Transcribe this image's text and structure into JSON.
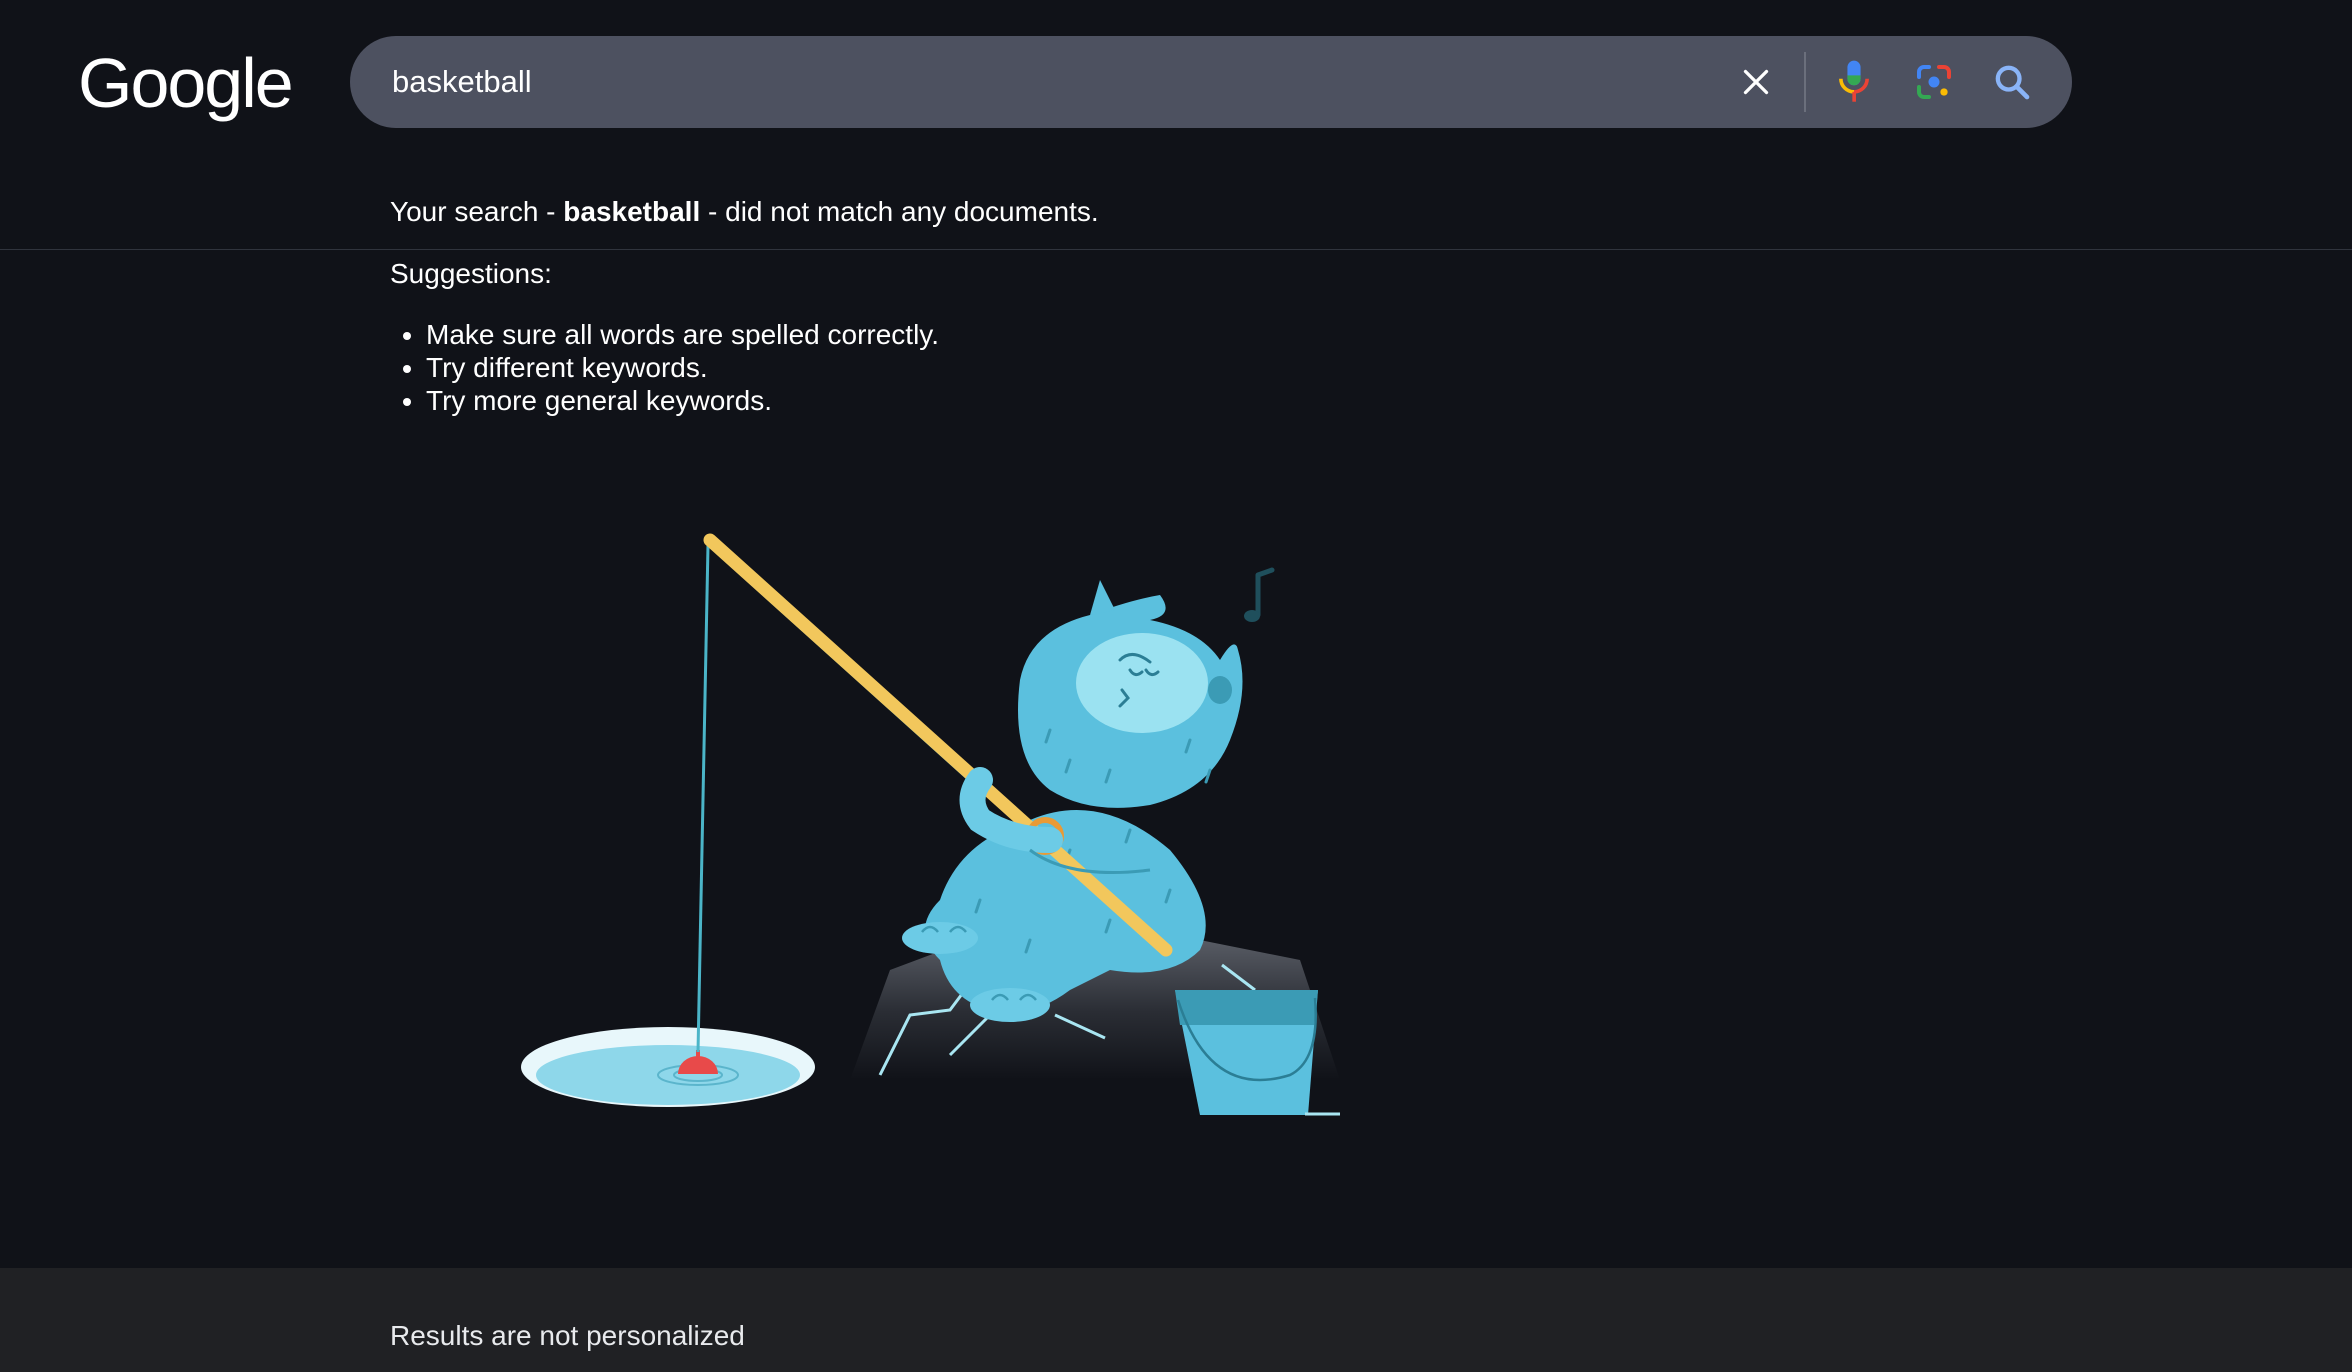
{
  "header": {
    "logo_text": "Google"
  },
  "search": {
    "query": "basketball",
    "clear_icon": "close-icon",
    "voice_icon": "microphone-icon",
    "lens_icon": "camera-lens-icon",
    "search_icon": "search-icon"
  },
  "results": {
    "message_prefix": "Your search - ",
    "message_query": "basketball",
    "message_suffix": " - did not match any documents.",
    "suggestions_label": "Suggestions:",
    "suggestions": [
      "Make sure all words are spelled correctly.",
      "Try different keywords.",
      "Try more general keywords."
    ]
  },
  "footer": {
    "text": "Results are not personalized"
  },
  "colors": {
    "background": "#101218",
    "searchbar": "#4d5160",
    "footer": "#202124",
    "accent_blue": "#8ab4f8",
    "character": "#5bc0de"
  }
}
